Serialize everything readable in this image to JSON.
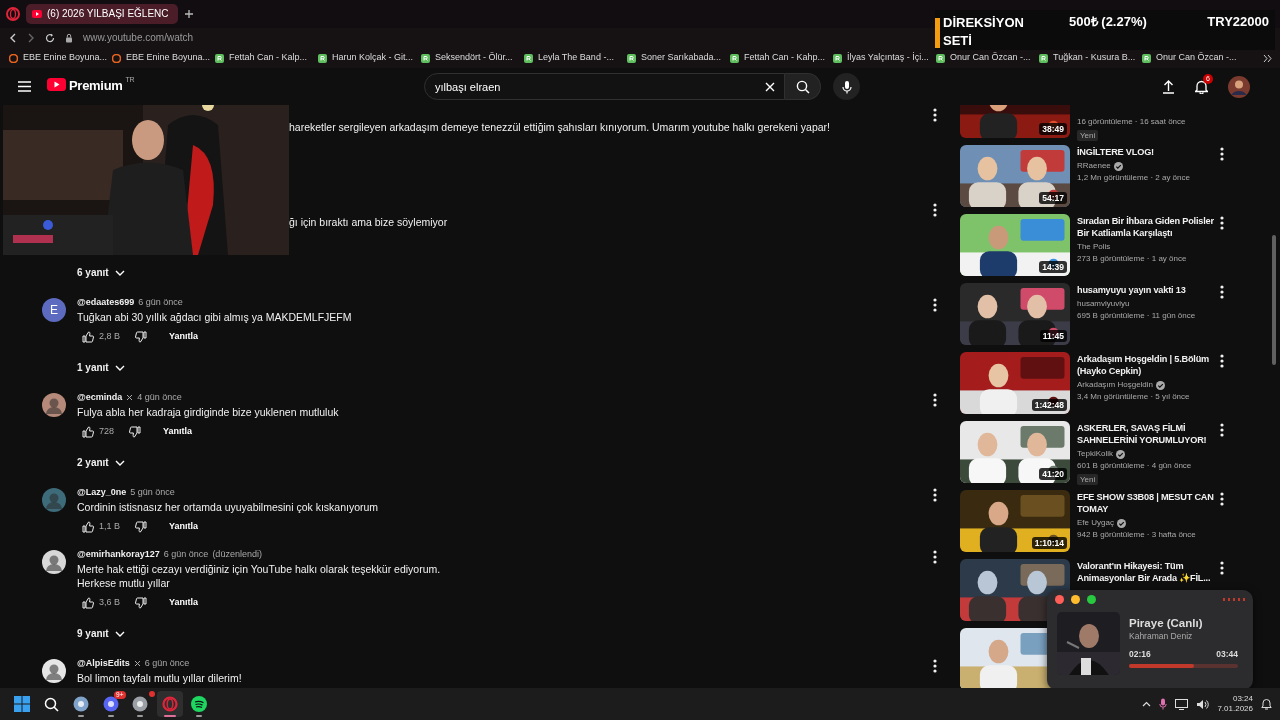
{
  "browser": {
    "tab": {
      "title": "(6) 2026 YILBAŞI EĞLENC",
      "selected": true
    },
    "url": "www.youtube.com/watch",
    "bookmarks": [
      {
        "label": "EBE Enine Boyuna...",
        "kind": "circle"
      },
      {
        "label": "EBE Enine Boyuna...",
        "kind": "circle"
      },
      {
        "label": "Fettah Can - Kalp...",
        "kind": "square"
      },
      {
        "label": "Harun Kolçak - Git...",
        "kind": "square"
      },
      {
        "label": "Seksendört - Ölür...",
        "kind": "square"
      },
      {
        "label": "Leyla The Band -...",
        "kind": "square"
      },
      {
        "label": "Soner Sarıkabada...",
        "kind": "square"
      },
      {
        "label": "Fettah Can - Kahp...",
        "kind": "square"
      },
      {
        "label": "İlyas Yalçıntaş - İçi...",
        "kind": "square"
      },
      {
        "label": "Onur Can Özcan -...",
        "kind": "square"
      },
      {
        "label": "Tuğkan - Kusura B...",
        "kind": "square"
      },
      {
        "label": "Onur Can Özcan -...",
        "kind": "square"
      }
    ]
  },
  "ticker": {
    "title": "DİREKSİYON SETİ",
    "change": "500₺ (2.27%)",
    "price": "TRY22000"
  },
  "header": {
    "logo": "Premium",
    "region": "TR",
    "search": {
      "value": "yılbaşı elraen"
    },
    "notifications": "6"
  },
  "comments": [
    {
      "kind": "partial",
      "text": "hareketler sergileyen arkadaşım demeye tenezzül ettiğim şahısları kınıyorum. Umarım youtube halkı gerekeni yapar!"
    },
    {
      "kind": "partial",
      "text": "ğı için bıraktı ama bize söylemiyor",
      "replies": "6 yanıt"
    },
    {
      "kind": "comment",
      "author": "@edaates699",
      "marked": false,
      "time": "6 gün önce",
      "avatar": "E",
      "color": "#5c6bc0",
      "text": "Tuğkan abi 30 yıllık ağdacı gibi almış ya MAKDEMLFJEFM",
      "likes": "2,8 B",
      "reply": "Yanıtla",
      "replies": "1 yanıt"
    },
    {
      "kind": "comment",
      "author": "@ecminda",
      "marked": true,
      "time": "4 gün önce",
      "color": "#b58a7a",
      "text": "Fulya abla her kadraja girdiginde bize yuklenen mutluluk",
      "likes": "728",
      "reply": "Yanıtla",
      "replies": "2 yanıt"
    },
    {
      "kind": "comment",
      "author": "@Lazy_0ne",
      "marked": false,
      "time": "5 gün önce",
      "color": "#3d6b7a",
      "text": "Cordinin istisnasız her ortamda uyuyabilmesini çok kıskanıyorum",
      "likes": "1,1 B",
      "reply": "Yanıtla"
    },
    {
      "kind": "comment",
      "author": "@emirhankoray127",
      "marked": false,
      "time": "6 gün önce",
      "edited": "(düzenlendi)",
      "color": "#d8d8d8",
      "text": "Merte hak ettiği cezayı verdiğiniz için YouTube halkı olarak teşekkür ediyorum.\nHerkese mutlu yıllar",
      "likes": "3,6 B",
      "reply": "Yanıtla",
      "replies": "9 yanıt"
    },
    {
      "kind": "comment",
      "author": "@AlpisEdits",
      "marked": true,
      "time": "6 gün önce",
      "color": "#e6e6e6",
      "text": "Bol limon tayfalı mutlu yıllar dilerim!"
    }
  ],
  "recommendations": [
    {
      "kind": "clipped",
      "views": "16 görüntüleme · 16 saat önce",
      "duration": "38:49",
      "new": "Yeni"
    },
    {
      "kind": "video",
      "title": "İNGİLTERE VLOG!",
      "channel": "RRaenee",
      "verified": true,
      "views": "1,2 Mn görüntüleme · 2 ay önce",
      "duration": "54:17"
    },
    {
      "kind": "video",
      "title": "Sıradan Bir İhbara Giden Polisler Bir Katliamla Karşılaştı",
      "channel": "The Polis",
      "verified": false,
      "views": "273 B görüntüleme · 1 ay önce",
      "duration": "14:39"
    },
    {
      "kind": "video",
      "title": "husamyuyu yayın vakti 13",
      "channel": "husamviyuviyu",
      "verified": false,
      "views": "695 B görüntüleme · 11 gün önce",
      "duration": "11:45"
    },
    {
      "kind": "video",
      "title": "Arkadaşım Hoşgeldin | 5.Bölüm (Hayko Cepkin)",
      "channel": "Arkadaşım Hoşgeldin",
      "verified": true,
      "views": "3,4 Mn görüntüleme · 5 yıl önce",
      "duration": "1:42:48"
    },
    {
      "kind": "video",
      "title": "ASKERLER, SAVAŞ FİLMİ SAHNELERİNİ YORUMLUYOR!",
      "channel": "TepkiKolik",
      "verified": true,
      "views": "601 B görüntüleme · 4 gün önce",
      "duration": "41:20",
      "new": "Yeni"
    },
    {
      "kind": "video",
      "title": "EFE SHOW S3B08 | MESUT CAN TOMAY",
      "channel": "Efe Uygaç",
      "verified": true,
      "views": "942 B görüntüleme · 3 hafta önce",
      "duration": "1:10:14"
    },
    {
      "kind": "video",
      "title": "Valorant'ın Hikayesi: Tüm Animasyonlar Bir Arada ✨FİL..."
    },
    {
      "kind": "video"
    }
  ],
  "player": {
    "title": "Piraye (Canlı)",
    "artist": "Kahraman Deniz",
    "elapsed": "02:16",
    "total": "03:44",
    "level": 0.6
  },
  "taskbar": {
    "apps": [
      {
        "kind": "windows",
        "active": false
      },
      {
        "kind": "search",
        "active": false
      },
      {
        "kind": "app",
        "color": "#7fa3c9",
        "active": false
      },
      {
        "kind": "app",
        "color": "#5865f2",
        "badge": "9+",
        "active": false
      },
      {
        "kind": "app",
        "color": "#9aa0a6",
        "alert": true,
        "active": false
      },
      {
        "kind": "opera",
        "active": true
      },
      {
        "kind": "spotify",
        "active": false
      }
    ],
    "time": "03:24",
    "date": "7.01.2026"
  }
}
